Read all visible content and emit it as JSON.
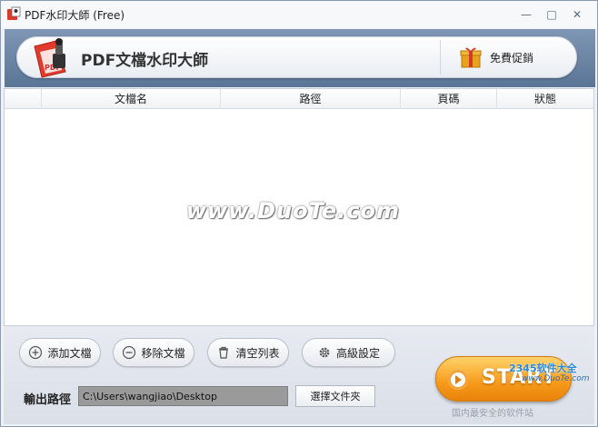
{
  "window": {
    "title": "PDF水印大師 (Free)"
  },
  "header": {
    "brand_title": "PDF文檔水印大師",
    "promo_label": "免費促銷"
  },
  "table": {
    "columns": [
      "文檔名",
      "路徑",
      "頁碼",
      "狀態"
    ],
    "rows": [],
    "watermark_text": "www.DuoTe.com"
  },
  "toolbar": {
    "add_label": "添加文檔",
    "remove_label": "移除文檔",
    "clear_label": "清空列表",
    "advanced_label": "高級設定"
  },
  "output": {
    "label": "輸出路徑",
    "path_value": "C:\\Users\\wangjiao\\Desktop",
    "browse_label": "選擇文件夾"
  },
  "start": {
    "label": "START"
  },
  "overlay": {
    "badge": "2345软件大全",
    "url": "www.DuoTe.com",
    "slogan": "国内最安全的软件站"
  },
  "colors": {
    "header_band": "#6b84a6",
    "start_orange": "#f79a1a",
    "path_field_bg": "#9a9a9a"
  }
}
